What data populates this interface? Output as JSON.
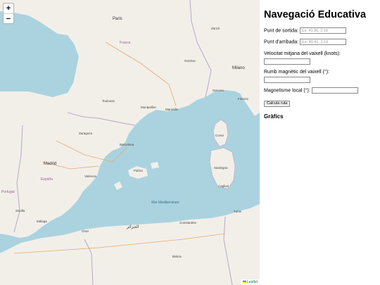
{
  "map": {
    "zoom_in": "+",
    "zoom_out": "−",
    "attribution": "Leaflet",
    "sea_color": "#aad3df",
    "land_color": "#f2efe9",
    "labels": {
      "france": "France",
      "paris": "Paris",
      "toulouse": "Toulouse",
      "montpellier": "Montpellier",
      "marseille": "Marseille",
      "zaragoza": "Zaragoza",
      "barcelona": "Barcelona",
      "madrid": "Madrid",
      "valencia": "València",
      "espana": "España",
      "palma": "Palma",
      "sevilla": "Sevilla",
      "malaga": "Málaga",
      "portugal": "Portugal",
      "zurich": "Zürich",
      "geneve": "Genève",
      "milano": "Milano",
      "genova": "Genova",
      "firenze": "Firenze",
      "corse": "Corse",
      "sardegna": "Sardegna",
      "cagliari": "Cagliari",
      "alger": "الجزائر",
      "constantine": "Constantine",
      "tunis": "Tunis",
      "oran": "Oran",
      "mediterranean": "Mar Mediterráneo",
      "biskra": "Biskra"
    }
  },
  "panel": {
    "title": "Navegació Educativa",
    "start_label": "Punt de sortida:",
    "start_placeholder": "Ex: 41.36, 2.19",
    "end_label": "Punt d'arribada:",
    "end_placeholder": "Ex: 40.41, 2.19",
    "speed_label": "Velocitat mitjana del vaixell (knots):",
    "heading_label": "Rumb magnètic del vaixell (°):",
    "magnetism_label": "Magnetisme local (°):",
    "calc_button": "Calcula ruta",
    "charts_heading": "Gràfics"
  }
}
